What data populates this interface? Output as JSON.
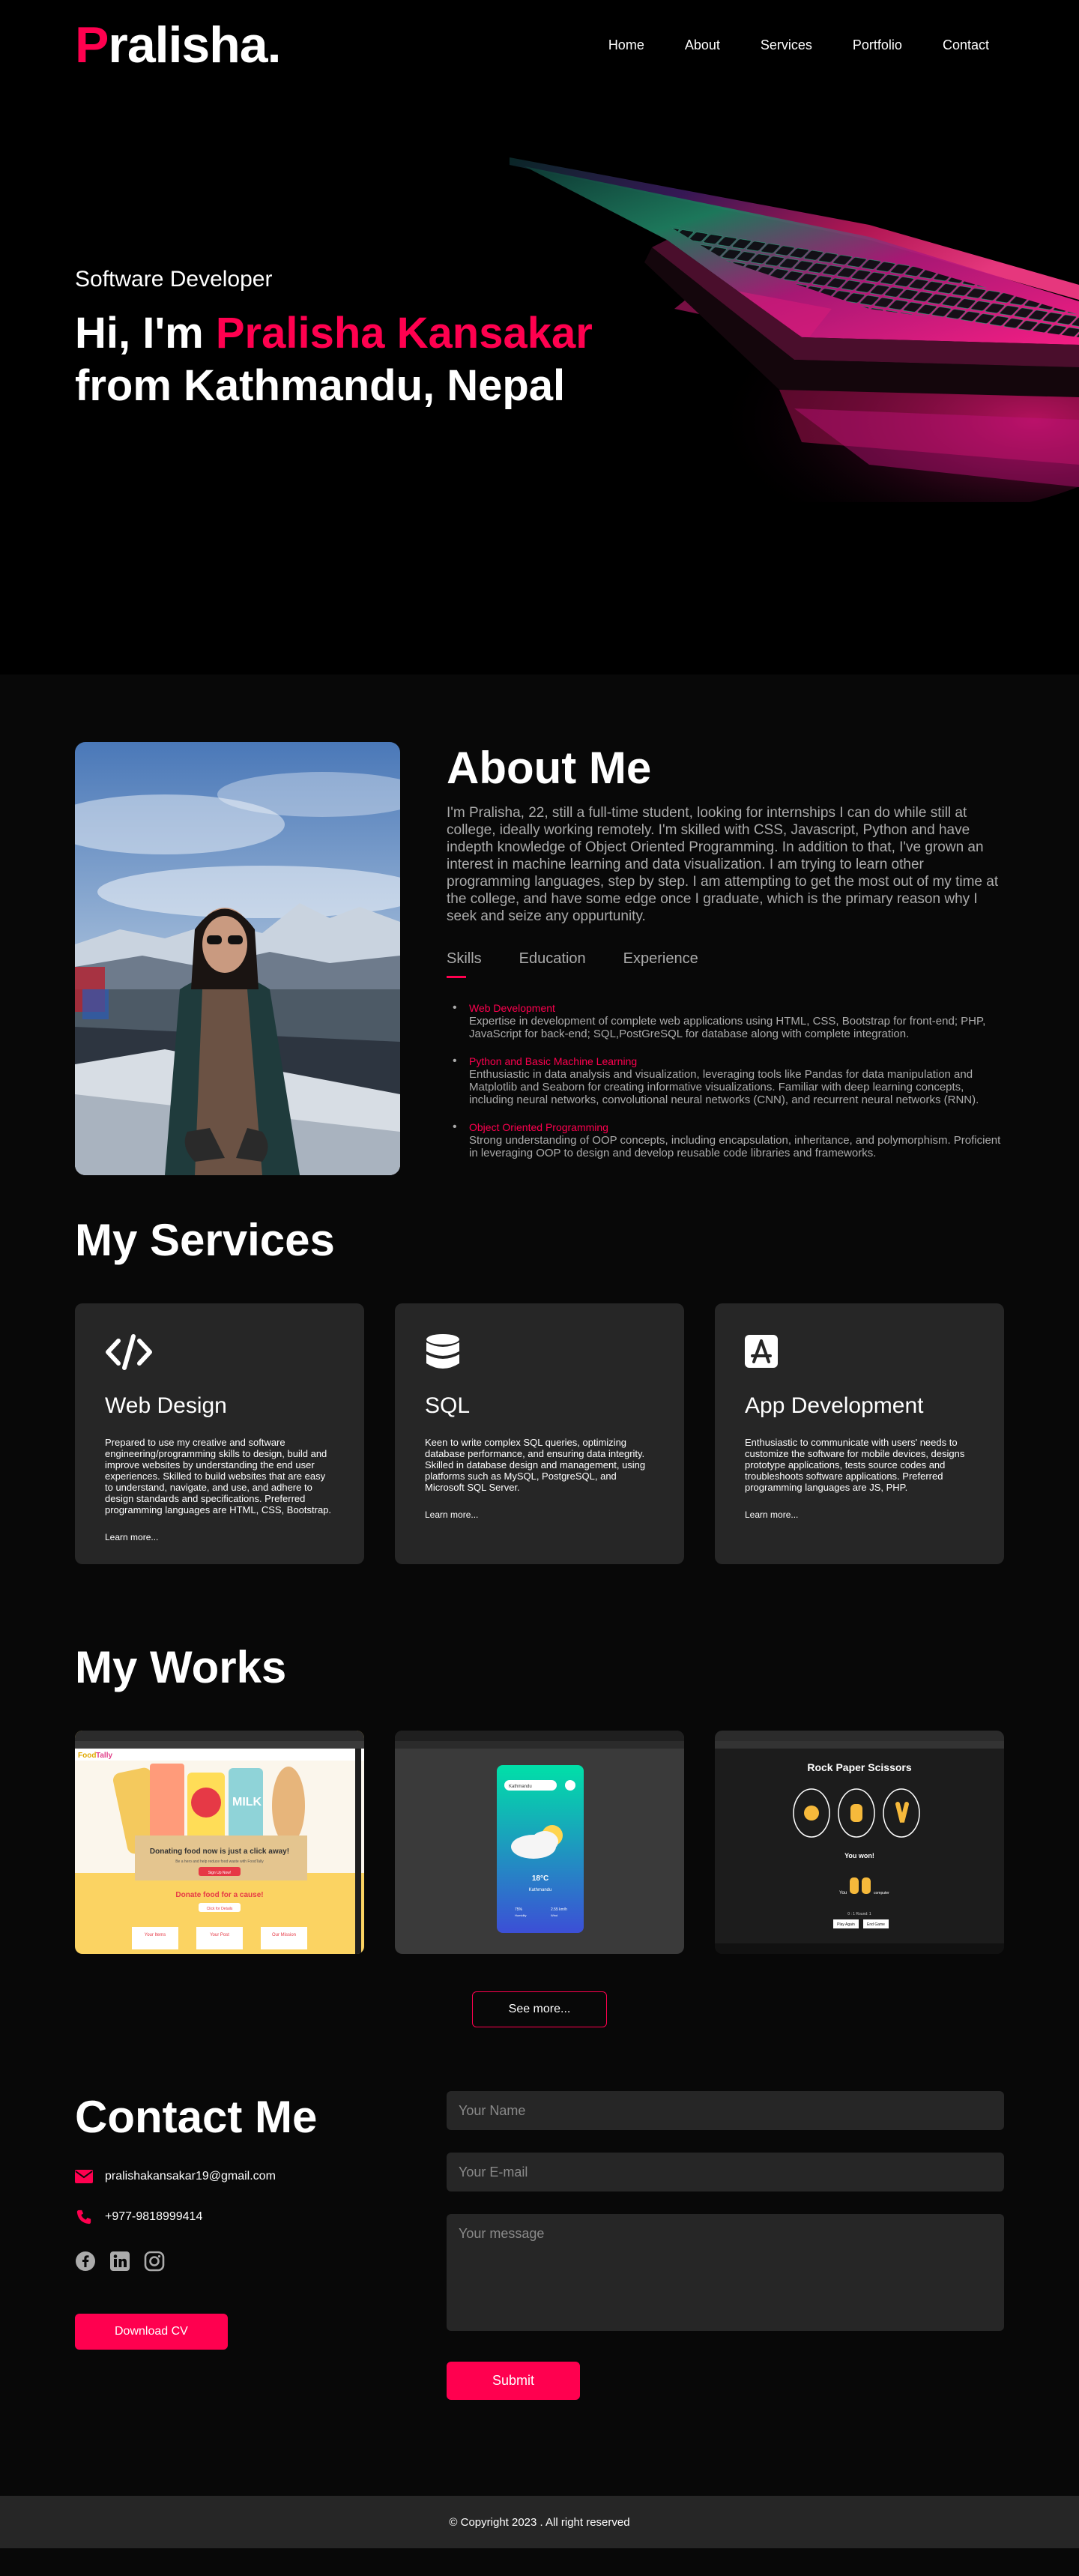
{
  "nav": {
    "logo_initial": "P",
    "logo_rest": "ralisha.",
    "links": [
      "Home",
      "About",
      "Services",
      "Portfolio",
      "Contact"
    ]
  },
  "hero": {
    "subtitle": "Software Developer",
    "line1_prefix": "Hi, I'm ",
    "line1_name": "Pralisha Kansakar",
    "line2": "from Kathmandu, Nepal"
  },
  "about": {
    "title": "About Me",
    "description": "I'm Pralisha, 22, still a full-time student, looking for internships I can do while still at college, ideally working remotely. I'm skilled with CSS, Javascript, Python and have indepth knowledge of Object Oriented Programming. In addition to that, I've grown an interest in machine learning and data visualization. I am trying to learn other programming languages, step by step. I am attempting to get the most out of my time at the college, and have some edge once I graduate, which is the primary reason why I seek and seize any oppurtunity.",
    "tabs": [
      "Skills",
      "Education",
      "Experience"
    ],
    "skills": [
      {
        "title": "Web Development",
        "text": "Expertise in development of complete web applications using HTML, CSS, Bootstrap for front-end; PHP, JavaScript for back-end; SQL,PostGreSQL for database along with complete integration."
      },
      {
        "title": "Python and Basic Machine Learning",
        "text": "Enthusiastic in data analysis and visualization, leveraging tools like Pandas for data manipulation and Matplotlib and Seaborn for creating informative visualizations. Familiar with deep learning concepts, including neural networks, convolutional neural networks (CNN), and recurrent neural networks (RNN)."
      },
      {
        "title": "Object Oriented Programming",
        "text": "Strong understanding of OOP concepts, including encapsulation, inheritance, and polymorphism. Proficient in leveraging OOP to design and develop reusable code libraries and frameworks."
      }
    ]
  },
  "services": {
    "title": "My Services",
    "items": [
      {
        "icon": "code-icon",
        "title": "Web Design",
        "text": "Prepared to use my creative and software engineering/programming skills to design, build and improve websites by understanding the end user experiences. Skilled to build websites that are easy to understand, navigate, and use, and adhere to design standards and specifications. Preferred programming languages are HTML, CSS, Bootstrap.",
        "link": "Learn more..."
      },
      {
        "icon": "database-icon",
        "title": "SQL",
        "text": "Keen to write complex SQL queries, optimizing database performance, and ensuring data integrity. Skilled in database design and management, using platforms such as MySQL, PostgreSQL, and Microsoft SQL Server.",
        "link": "Learn more..."
      },
      {
        "icon": "app-store-icon",
        "title": "App Development",
        "text": "Enthusiastic to communicate with users' needs to customize the software for mobile devices, designs prototype applications, tests source codes and troubleshoots software applications. Preferred programming languages are JS, PHP.",
        "link": "Learn more..."
      }
    ]
  },
  "works": {
    "title": "My Works",
    "see_more": "See more...",
    "items": [
      {
        "app_name_food": "Food",
        "app_name_tally": "Tally",
        "headline": "Donating food now is just a click away!",
        "subline": "Be a hero and help reduce food waste with FoodTally",
        "cta": "Sign Up Now!",
        "banner": "Donate food for a cause!",
        "banner_btn": "Click for Details",
        "cards": [
          "Your Items",
          "Your Post",
          "Our Mission"
        ],
        "milk": "MILK"
      },
      {
        "search_text": "Kathmandu",
        "temp": "18°C",
        "city": "Kathmandu",
        "stat1": "75%",
        "stat1_label": "Humidity",
        "stat2": "2.55 km/h",
        "stat2_label": "Wind"
      },
      {
        "title": "Rock Paper Scissors",
        "result": "You won!",
        "you_label": "You",
        "computer_label": "computer",
        "score": "0 : 1   Round: 1",
        "btn1": "Play Again",
        "btn2": "End Game"
      }
    ]
  },
  "contact": {
    "title": "Contact Me",
    "email": "pralishakansakar19@gmail.com",
    "phone": "+977-9818999414",
    "download_cv": "Download CV",
    "name_placeholder": "Your Name",
    "email_placeholder": "Your E-mail",
    "message_placeholder": "Your message",
    "submit": "Submit"
  },
  "footer": {
    "copyright": "© Copyright 2023 . All right reserved"
  },
  "colors": {
    "accent": "#ff004f",
    "card_bg": "#262626",
    "page_bg": "#080808",
    "muted_text": "#ababab"
  }
}
